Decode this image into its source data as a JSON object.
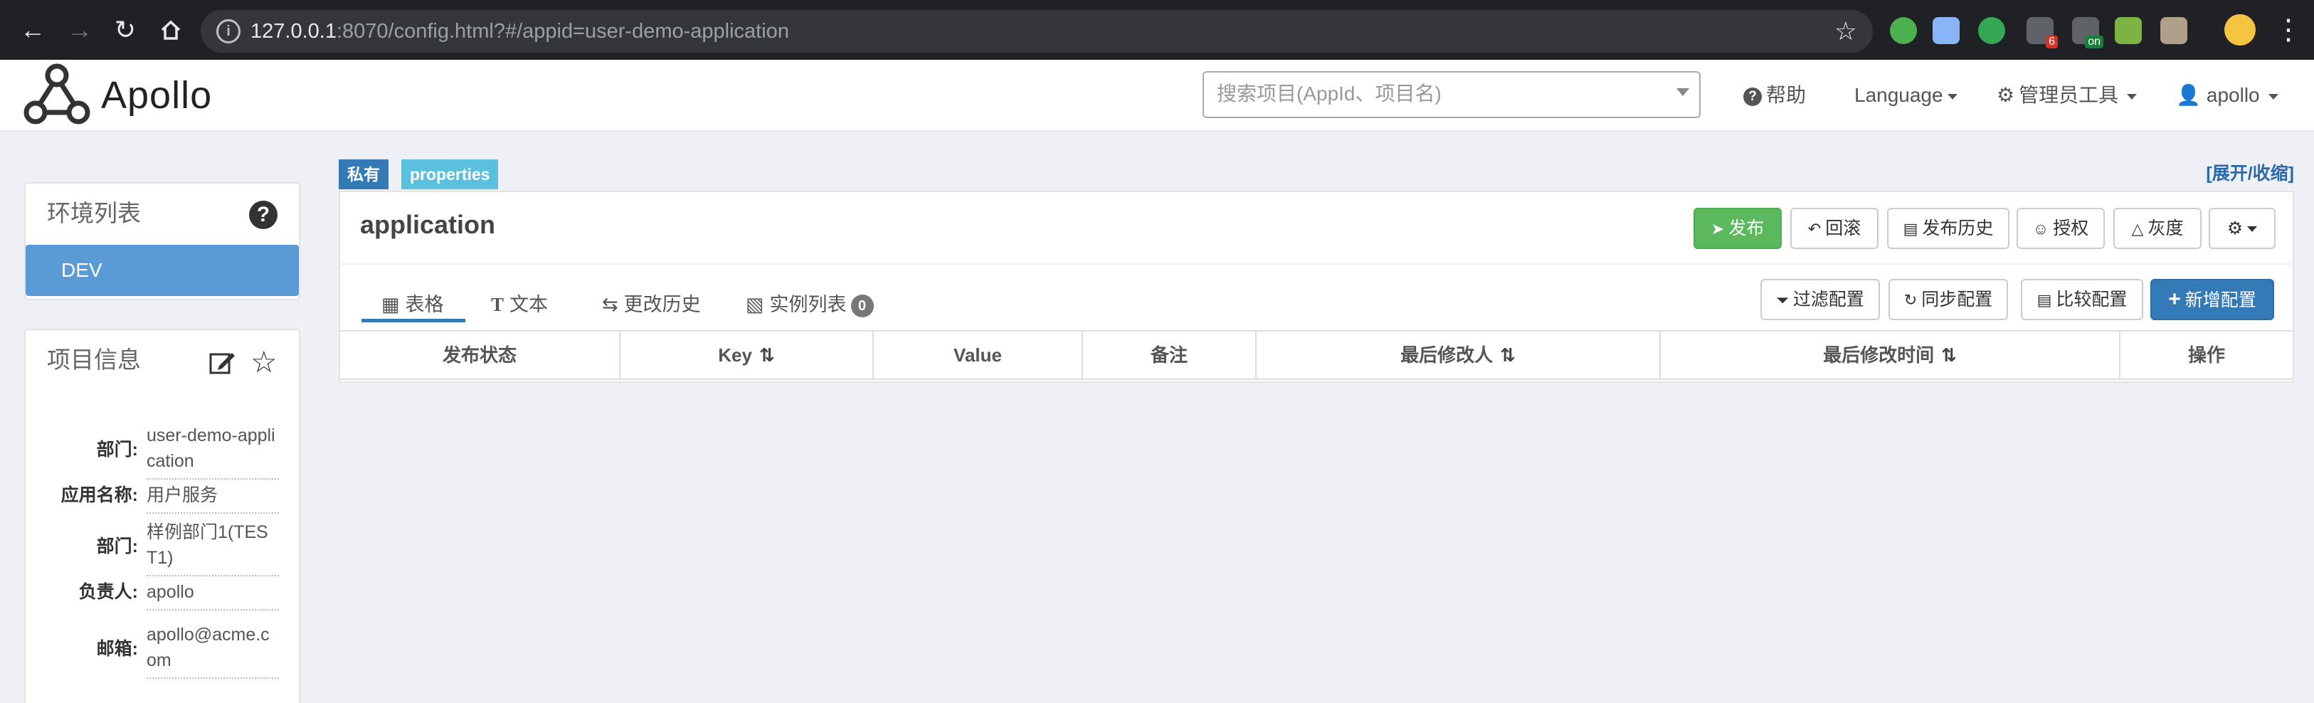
{
  "browser": {
    "url_host": "127.0.0.1",
    "url_rest": ":8070/config.html?#/appid=user-demo-application",
    "extensions": [
      {
        "name": "green-dot-extension-icon",
        "color": "#4caf50"
      },
      {
        "name": "diamond-extension-icon",
        "color": "#8ab4f8"
      },
      {
        "name": "y-extension-icon",
        "color": "#34a853"
      },
      {
        "name": "puzzle-extension-icon",
        "color": "#5f6368",
        "badge": "6"
      },
      {
        "name": "list-extension-icon",
        "color": "#5f6368",
        "badge": "on"
      },
      {
        "name": "eyedropper-extension-icon",
        "color": "#7cb342"
      },
      {
        "name": "avatar-extension-icon",
        "color": "#b0a08a"
      }
    ]
  },
  "nav": {
    "logo_text": "Apollo",
    "search_placeholder": "搜索项目(AppId、项目名)",
    "help": "帮助",
    "language": "Language",
    "admin_tools": "管理员工具",
    "user": "apollo"
  },
  "env_panel": {
    "title": "环境列表",
    "items": [
      "DEV"
    ]
  },
  "project_panel": {
    "title": "项目信息",
    "rows": [
      {
        "label": "部门:",
        "value": "user-demo-application"
      },
      {
        "label": "应用名称:",
        "value": "用户服务"
      },
      {
        "label": "部门:",
        "value": "样例部门1(TEST1)"
      },
      {
        "label": "负责人:",
        "value": "apollo"
      },
      {
        "label": "邮箱:",
        "value": "apollo@acme.com"
      }
    ]
  },
  "namespace": {
    "tag_private": "私有",
    "tag_format": "properties",
    "expand_collapse": "[展开/收缩]",
    "title": "application",
    "actions": {
      "publish": "发布",
      "rollback": "回滚",
      "publish_history": "发布历史",
      "authorize": "授权",
      "gray": "灰度"
    },
    "tabs": [
      {
        "label": "表格"
      },
      {
        "label": "文本"
      },
      {
        "label": "更改历史"
      },
      {
        "label": "实例列表",
        "count": "0"
      }
    ],
    "tools": {
      "filter": "过滤配置",
      "sync": "同步配置",
      "compare": "比较配置",
      "add": "新增配置"
    },
    "columns": [
      "发布状态",
      "Key",
      "Value",
      "备注",
      "最后修改人",
      "最后修改时间",
      "操作"
    ],
    "colors": {
      "accent": "#337ab7",
      "success": "#5cb85c",
      "env_item": "#5b9bd5",
      "tag_private": "#337ab7",
      "tag_format": "#5bc0de"
    }
  }
}
